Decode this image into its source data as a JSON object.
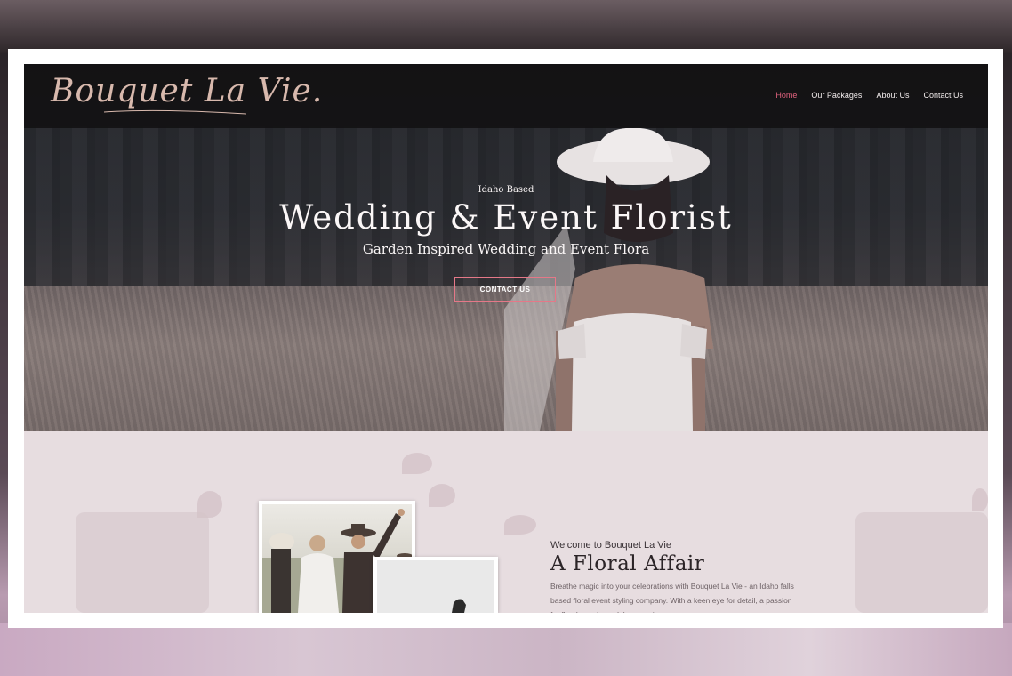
{
  "site": {
    "logo_text": "Bouquet La Vie."
  },
  "nav": {
    "items": [
      {
        "label": "Home",
        "active": true
      },
      {
        "label": "Our Packages",
        "active": false
      },
      {
        "label": "About Us",
        "active": false
      },
      {
        "label": "Contact Us",
        "active": false
      }
    ]
  },
  "hero": {
    "kicker": "Idaho Based",
    "title": "Wedding & Event Florist",
    "subtitle": "Garden Inspired Wedding and Event Flora",
    "cta_label": "CONTACT US"
  },
  "about": {
    "welcome": "Welcome to Bouquet La Vie",
    "title": "A Floral Affair",
    "body": "Breathe magic into your celebrations with Bouquet La Vie - an Idaho falls based floral event styling company. With a keen eye for detail, a passion for floral events, and the experience"
  },
  "colors": {
    "accent": "#e0627d",
    "nav_bg": "#121012",
    "about_bg": "#e7dde0"
  }
}
